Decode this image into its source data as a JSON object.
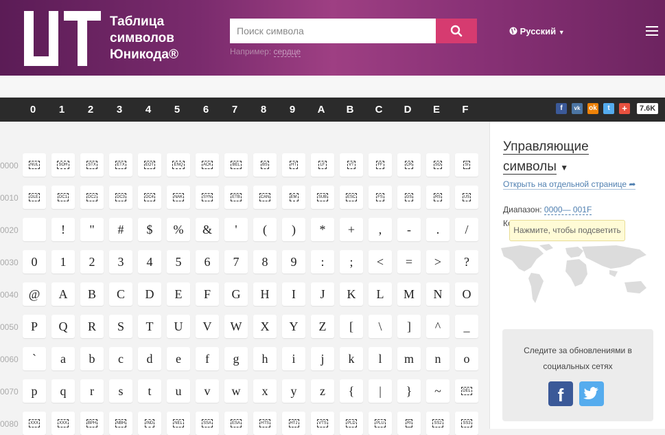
{
  "header": {
    "logo_text": "UT",
    "title_lines": [
      "Таблица",
      "символов",
      "Юникода®"
    ],
    "search_placeholder": "Поиск символа",
    "hint_prefix": "Например:",
    "hint_example": "сердце",
    "language": "Русский"
  },
  "hexbar": {
    "digits": [
      "0",
      "1",
      "2",
      "3",
      "4",
      "5",
      "6",
      "7",
      "8",
      "9",
      "A",
      "B",
      "C",
      "D",
      "E",
      "F"
    ],
    "share_count": "7.6K"
  },
  "grid": {
    "rows": [
      {
        "label": "0000",
        "cells": [
          "NUL",
          "SOH",
          "STX",
          "ETX",
          "EOT",
          "ENQ",
          "ACK",
          "BEL",
          "BS",
          "HT",
          "LF",
          "VT",
          "FF",
          "CR",
          "SO",
          "SI"
        ],
        "control": true
      },
      {
        "label": "0010",
        "cells": [
          "DLE",
          "DC1",
          "DC2",
          "DC3",
          "DC4",
          "NAK",
          "SYN",
          "ETB",
          "CAN",
          "EM",
          "SUB",
          "ESC",
          "FS",
          "GS",
          "RS",
          "US"
        ],
        "control": true
      },
      {
        "label": "0020",
        "cells": [
          " ",
          "!",
          "\"",
          "#",
          "$",
          "%",
          "&",
          "'",
          "(",
          ")",
          "*",
          "+",
          ",",
          "-",
          ".",
          "/"
        ],
        "control": false
      },
      {
        "label": "0030",
        "cells": [
          "0",
          "1",
          "2",
          "3",
          "4",
          "5",
          "6",
          "7",
          "8",
          "9",
          ":",
          ";",
          "<",
          "=",
          ">",
          "?"
        ],
        "control": false
      },
      {
        "label": "0040",
        "cells": [
          "@",
          "A",
          "B",
          "C",
          "D",
          "E",
          "F",
          "G",
          "H",
          "I",
          "J",
          "K",
          "L",
          "M",
          "N",
          "O"
        ],
        "control": false
      },
      {
        "label": "0050",
        "cells": [
          "P",
          "Q",
          "R",
          "S",
          "T",
          "U",
          "V",
          "W",
          "X",
          "Y",
          "Z",
          "[",
          "\\",
          "]",
          "^",
          "_"
        ],
        "control": false
      },
      {
        "label": "0060",
        "cells": [
          "`",
          "a",
          "b",
          "c",
          "d",
          "e",
          "f",
          "g",
          "h",
          "i",
          "j",
          "k",
          "l",
          "m",
          "n",
          "o"
        ],
        "control": false
      },
      {
        "label": "0070",
        "cells": [
          "p",
          "q",
          "r",
          "s",
          "t",
          "u",
          "v",
          "w",
          "x",
          "y",
          "z",
          "{",
          "|",
          "}",
          "~",
          "DEL"
        ],
        "control": false,
        "last_control": true
      },
      {
        "label": "0080",
        "cells": [
          "XXX",
          "XXX",
          "BPH",
          "NBH",
          "IND",
          "NEL",
          "SSA",
          "ESA",
          "HTS",
          "HTJ",
          "VTS",
          "PLD",
          "PLU",
          "RI",
          "SS2",
          "SS3"
        ],
        "control": true
      }
    ]
  },
  "panel": {
    "title_line1": "Управляющие",
    "title_line2": "символы",
    "open_link": "Открыть на отдельной странице",
    "range_label": "Диапазон:",
    "range_value": "0000— 001F",
    "range2_partial": "Ко",
    "tooltip": "Нажмите, чтобы подсветить",
    "follow_text": "Следите за обновлениями в социальных сетях"
  },
  "colors": {
    "accent": "#d63b70",
    "hexbar_bg": "#2b2b2b",
    "facebook": "#3b5998",
    "twitter": "#55acee"
  }
}
